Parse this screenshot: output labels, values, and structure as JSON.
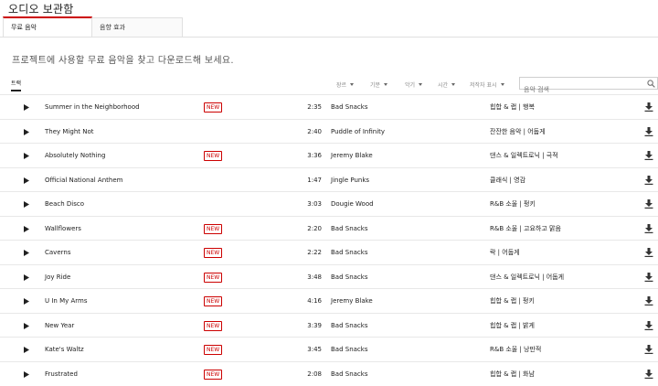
{
  "page": {
    "title": "오디오 보관함"
  },
  "tabs": [
    {
      "label": "무료 음악",
      "active": true
    },
    {
      "label": "음향 효과",
      "active": false
    }
  ],
  "description": "프로젝트에 사용할 무료 음악을 찾고 다운로드해 보세요.",
  "toolbar": {
    "track_tab": "트랙",
    "filters": [
      "장르",
      "기분",
      "악기",
      "시간",
      "저작자 표시"
    ],
    "search_placeholder": "음악 검색"
  },
  "icons": {
    "play": "play-icon",
    "download": "download-icon",
    "search": "search-icon"
  },
  "colors": {
    "accent": "#cc0000",
    "text": "#212121",
    "divider": "#e8e8e8"
  },
  "tracks": [
    {
      "title": "Summer in the Neighborhood",
      "new": "NEW",
      "duration": "2:35",
      "artist": "Bad Snacks",
      "genre": "힙합 & 랩 | 행복"
    },
    {
      "title": "They Might Not",
      "new": "",
      "duration": "2:40",
      "artist": "Puddle of Infinity",
      "genre": "잔잔한 음악 | 어둡게"
    },
    {
      "title": "Absolutely Nothing",
      "new": "NEW",
      "duration": "3:36",
      "artist": "Jeremy Blake",
      "genre": "댄스 & 일렉트로닉 | 극적"
    },
    {
      "title": "Official National Anthem",
      "new": "",
      "duration": "1:47",
      "artist": "Jingle Punks",
      "genre": "클래식 | 영감"
    },
    {
      "title": "Beach Disco",
      "new": "",
      "duration": "3:03",
      "artist": "Dougie Wood",
      "genre": "R&B 소울 | 펑키"
    },
    {
      "title": "Wallflowers",
      "new": "NEW",
      "duration": "2:20",
      "artist": "Bad Snacks",
      "genre": "R&B 소울 | 고요하고 맑음"
    },
    {
      "title": "Caverns",
      "new": "NEW",
      "duration": "2:22",
      "artist": "Bad Snacks",
      "genre": "락 | 어둡게"
    },
    {
      "title": "Joy Ride",
      "new": "NEW",
      "duration": "3:48",
      "artist": "Bad Snacks",
      "genre": "댄스 & 일렉트로닉 | 어둡게"
    },
    {
      "title": "U In My Arms",
      "new": "NEW",
      "duration": "4:16",
      "artist": "Jeremy Blake",
      "genre": "힙합 & 랩 | 펑키"
    },
    {
      "title": "New Year",
      "new": "NEW",
      "duration": "3:39",
      "artist": "Bad Snacks",
      "genre": "힙합 & 랩 | 밝게"
    },
    {
      "title": "Kate's Waltz",
      "new": "NEW",
      "duration": "3:45",
      "artist": "Bad Snacks",
      "genre": "R&B 소울 | 낭만적"
    },
    {
      "title": "Frustrated",
      "new": "NEW",
      "duration": "2:08",
      "artist": "Bad Snacks",
      "genre": "힙합 & 랩 | 화남"
    }
  ]
}
